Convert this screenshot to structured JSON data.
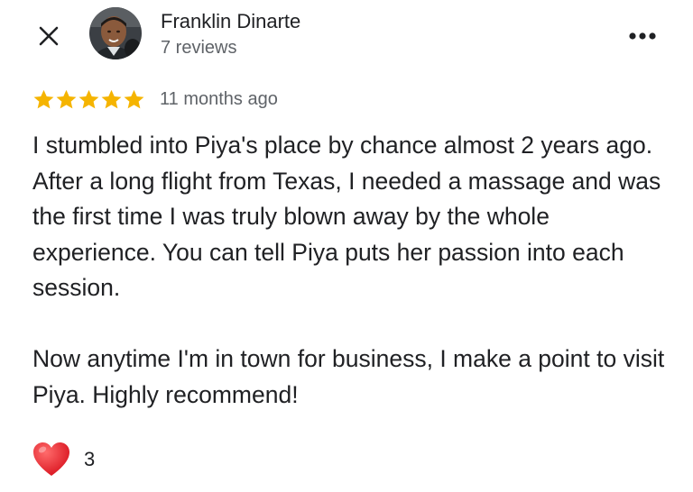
{
  "review": {
    "author_name": "Franklin Dinarte",
    "author_reviews": "7 reviews",
    "rating": 5,
    "rating_max": 5,
    "date": "11 months ago",
    "paragraphs": [
      "I stumbled into Piya's place by chance almost 2 years ago. After a long flight from Texas, I needed a massage and was the first time I was truly blown away by the whole experience. You can tell Piya puts her passion into each session.",
      "Now anytime I'm in town for business, I make a point to visit Piya. Highly recommend!"
    ],
    "reaction_count": "3"
  },
  "icons": {
    "close": "close-icon",
    "more": "more-horizontal-icon",
    "star": "star-icon",
    "heart": "heart-icon"
  },
  "colors": {
    "star": "#F5B400",
    "text_primary": "#202124",
    "text_secondary": "#5f6368",
    "heart": "#E8232E"
  }
}
